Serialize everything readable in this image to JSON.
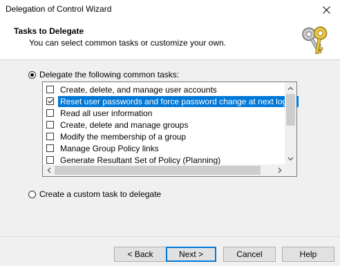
{
  "window": {
    "title": "Delegation of Control Wizard"
  },
  "header": {
    "title": "Tasks to Delegate",
    "subtitle": "You can select common tasks or customize your own."
  },
  "options": {
    "common": {
      "label": "Delegate the following common tasks:",
      "selected": true
    },
    "custom": {
      "label": "Create a custom task to delegate",
      "selected": false
    }
  },
  "tasks": [
    {
      "label": "Create, delete, and manage user accounts",
      "checked": false,
      "selected": false
    },
    {
      "label": "Reset user passwords and force password change at next logon",
      "checked": true,
      "selected": true
    },
    {
      "label": "Read all user information",
      "checked": false,
      "selected": false
    },
    {
      "label": "Create, delete and manage groups",
      "checked": false,
      "selected": false
    },
    {
      "label": "Modify the membership of a group",
      "checked": false,
      "selected": false
    },
    {
      "label": "Manage Group Policy links",
      "checked": false,
      "selected": false
    },
    {
      "label": "Generate Resultant Set of Policy (Planning)",
      "checked": false,
      "selected": false
    }
  ],
  "buttons": {
    "back": "< Back",
    "next": "Next >",
    "cancel": "Cancel",
    "help": "Help"
  },
  "colors": {
    "selection": "#0078d7"
  }
}
